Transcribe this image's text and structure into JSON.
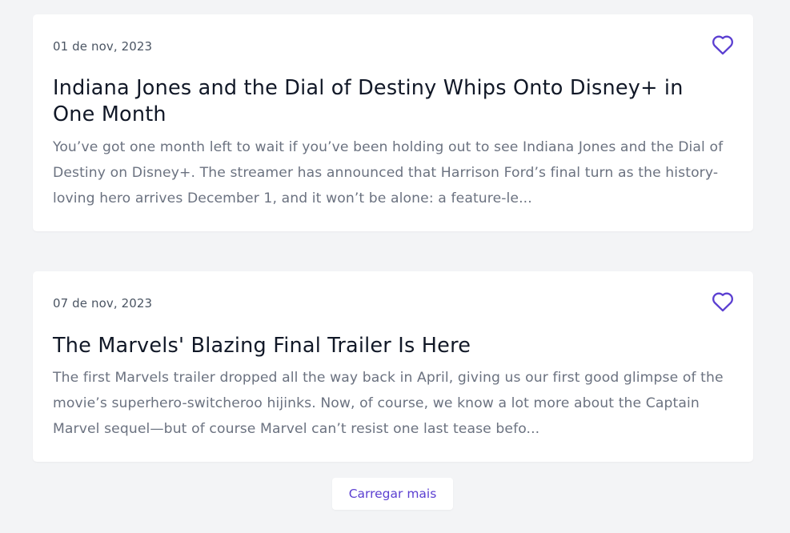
{
  "colors": {
    "background": "#f3f4f6",
    "card": "#ffffff",
    "accent": "#5b3fd1",
    "title": "#111827",
    "date": "#4b5563",
    "excerpt": "#6b7280"
  },
  "articles": [
    {
      "date": "01 de nov, 2023",
      "title": "Indiana Jones and the Dial of Destiny Whips Onto Disney+ in One Month",
      "excerpt": "You’ve got one month left to wait if you’ve been holding out to see Indiana Jones and the Dial of Destiny on Disney+. The streamer has announced that Harrison Ford’s final turn as the history-loving hero arrives December 1, and it won’t be alone: a feature-le...",
      "favorite_icon": "heart-outline-icon"
    },
    {
      "date": "07 de nov, 2023",
      "title": "The Marvels' Blazing Final Trailer Is Here",
      "excerpt": "The first Marvels trailer dropped all the way back in April, giving us our first good glimpse of the movie’s superhero-switcheroo hijinks. Now, of course, we know a lot more about the Captain Marvel sequel—but of course Marvel can’t resist one last tease befo...",
      "favorite_icon": "heart-outline-icon"
    }
  ],
  "load_more": {
    "label": "Carregar mais"
  }
}
